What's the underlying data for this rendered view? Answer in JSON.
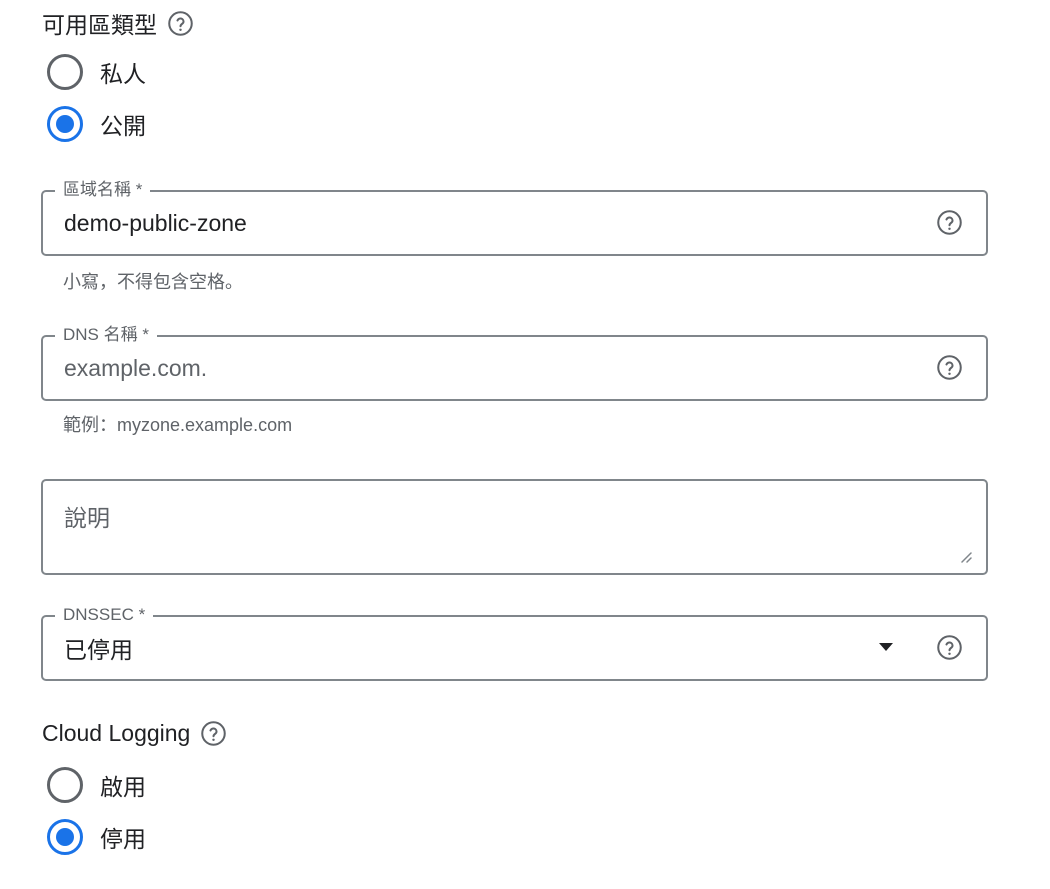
{
  "zone_type": {
    "title": "可用區類型",
    "help_icon": "help-circle-icon",
    "options": [
      {
        "label": "私人",
        "checked": false
      },
      {
        "label": "公開",
        "checked": true
      }
    ]
  },
  "zone_name": {
    "label": "區域名稱 *",
    "value": "demo-public-zone",
    "hint": "小寫，不得包含空格。"
  },
  "dns_name": {
    "label": "DNS 名稱 *",
    "placeholder": "example.com.",
    "hint": "範例：myzone.example.com"
  },
  "description": {
    "label": "說明",
    "value": ""
  },
  "dnssec": {
    "label": "DNSSEC *",
    "selected": "已停用"
  },
  "cloud_logging": {
    "title": "Cloud Logging",
    "options": [
      {
        "label": "啟用",
        "checked": false
      },
      {
        "label": "停用",
        "checked": true
      }
    ]
  },
  "colors": {
    "accent": "#1a73e8",
    "border": "#80868b",
    "secondary_text": "#5f6368"
  }
}
